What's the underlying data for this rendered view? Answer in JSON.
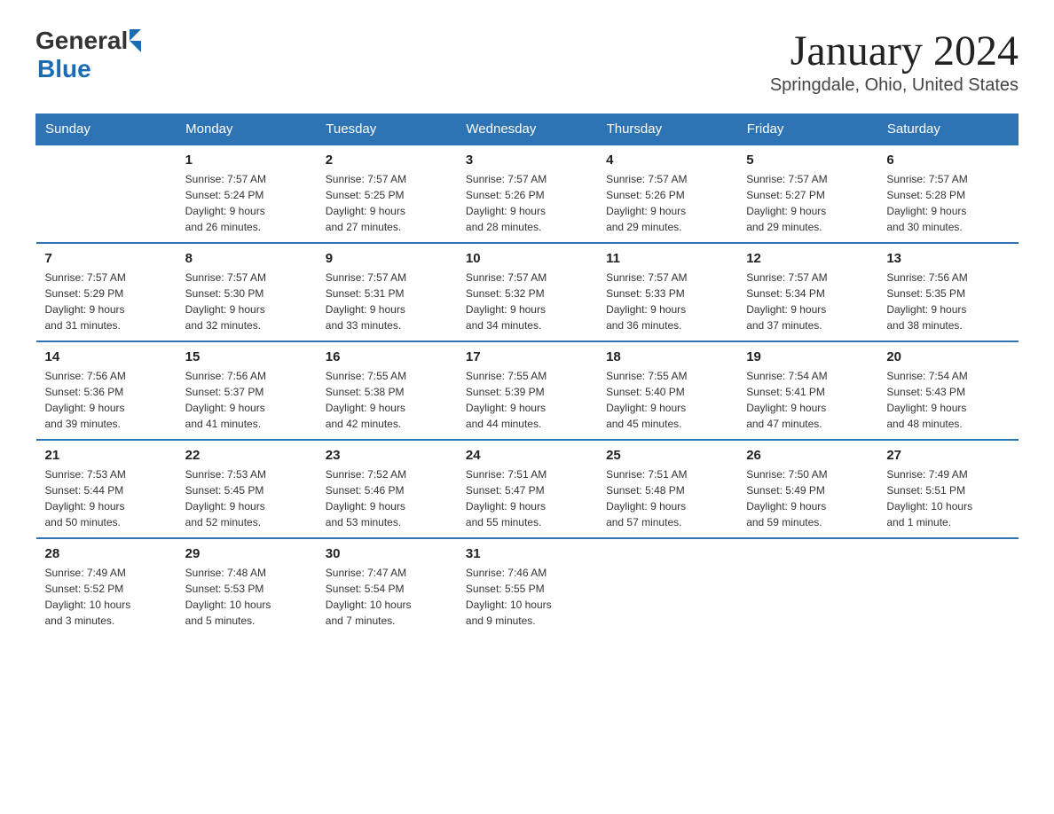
{
  "header": {
    "logo_general": "General",
    "logo_blue": "Blue",
    "month_title": "January 2024",
    "location": "Springdale, Ohio, United States"
  },
  "days_of_week": [
    "Sunday",
    "Monday",
    "Tuesday",
    "Wednesday",
    "Thursday",
    "Friday",
    "Saturday"
  ],
  "weeks": [
    [
      {
        "num": "",
        "info": ""
      },
      {
        "num": "1",
        "info": "Sunrise: 7:57 AM\nSunset: 5:24 PM\nDaylight: 9 hours\nand 26 minutes."
      },
      {
        "num": "2",
        "info": "Sunrise: 7:57 AM\nSunset: 5:25 PM\nDaylight: 9 hours\nand 27 minutes."
      },
      {
        "num": "3",
        "info": "Sunrise: 7:57 AM\nSunset: 5:26 PM\nDaylight: 9 hours\nand 28 minutes."
      },
      {
        "num": "4",
        "info": "Sunrise: 7:57 AM\nSunset: 5:26 PM\nDaylight: 9 hours\nand 29 minutes."
      },
      {
        "num": "5",
        "info": "Sunrise: 7:57 AM\nSunset: 5:27 PM\nDaylight: 9 hours\nand 29 minutes."
      },
      {
        "num": "6",
        "info": "Sunrise: 7:57 AM\nSunset: 5:28 PM\nDaylight: 9 hours\nand 30 minutes."
      }
    ],
    [
      {
        "num": "7",
        "info": "Sunrise: 7:57 AM\nSunset: 5:29 PM\nDaylight: 9 hours\nand 31 minutes."
      },
      {
        "num": "8",
        "info": "Sunrise: 7:57 AM\nSunset: 5:30 PM\nDaylight: 9 hours\nand 32 minutes."
      },
      {
        "num": "9",
        "info": "Sunrise: 7:57 AM\nSunset: 5:31 PM\nDaylight: 9 hours\nand 33 minutes."
      },
      {
        "num": "10",
        "info": "Sunrise: 7:57 AM\nSunset: 5:32 PM\nDaylight: 9 hours\nand 34 minutes."
      },
      {
        "num": "11",
        "info": "Sunrise: 7:57 AM\nSunset: 5:33 PM\nDaylight: 9 hours\nand 36 minutes."
      },
      {
        "num": "12",
        "info": "Sunrise: 7:57 AM\nSunset: 5:34 PM\nDaylight: 9 hours\nand 37 minutes."
      },
      {
        "num": "13",
        "info": "Sunrise: 7:56 AM\nSunset: 5:35 PM\nDaylight: 9 hours\nand 38 minutes."
      }
    ],
    [
      {
        "num": "14",
        "info": "Sunrise: 7:56 AM\nSunset: 5:36 PM\nDaylight: 9 hours\nand 39 minutes."
      },
      {
        "num": "15",
        "info": "Sunrise: 7:56 AM\nSunset: 5:37 PM\nDaylight: 9 hours\nand 41 minutes."
      },
      {
        "num": "16",
        "info": "Sunrise: 7:55 AM\nSunset: 5:38 PM\nDaylight: 9 hours\nand 42 minutes."
      },
      {
        "num": "17",
        "info": "Sunrise: 7:55 AM\nSunset: 5:39 PM\nDaylight: 9 hours\nand 44 minutes."
      },
      {
        "num": "18",
        "info": "Sunrise: 7:55 AM\nSunset: 5:40 PM\nDaylight: 9 hours\nand 45 minutes."
      },
      {
        "num": "19",
        "info": "Sunrise: 7:54 AM\nSunset: 5:41 PM\nDaylight: 9 hours\nand 47 minutes."
      },
      {
        "num": "20",
        "info": "Sunrise: 7:54 AM\nSunset: 5:43 PM\nDaylight: 9 hours\nand 48 minutes."
      }
    ],
    [
      {
        "num": "21",
        "info": "Sunrise: 7:53 AM\nSunset: 5:44 PM\nDaylight: 9 hours\nand 50 minutes."
      },
      {
        "num": "22",
        "info": "Sunrise: 7:53 AM\nSunset: 5:45 PM\nDaylight: 9 hours\nand 52 minutes."
      },
      {
        "num": "23",
        "info": "Sunrise: 7:52 AM\nSunset: 5:46 PM\nDaylight: 9 hours\nand 53 minutes."
      },
      {
        "num": "24",
        "info": "Sunrise: 7:51 AM\nSunset: 5:47 PM\nDaylight: 9 hours\nand 55 minutes."
      },
      {
        "num": "25",
        "info": "Sunrise: 7:51 AM\nSunset: 5:48 PM\nDaylight: 9 hours\nand 57 minutes."
      },
      {
        "num": "26",
        "info": "Sunrise: 7:50 AM\nSunset: 5:49 PM\nDaylight: 9 hours\nand 59 minutes."
      },
      {
        "num": "27",
        "info": "Sunrise: 7:49 AM\nSunset: 5:51 PM\nDaylight: 10 hours\nand 1 minute."
      }
    ],
    [
      {
        "num": "28",
        "info": "Sunrise: 7:49 AM\nSunset: 5:52 PM\nDaylight: 10 hours\nand 3 minutes."
      },
      {
        "num": "29",
        "info": "Sunrise: 7:48 AM\nSunset: 5:53 PM\nDaylight: 10 hours\nand 5 minutes."
      },
      {
        "num": "30",
        "info": "Sunrise: 7:47 AM\nSunset: 5:54 PM\nDaylight: 10 hours\nand 7 minutes."
      },
      {
        "num": "31",
        "info": "Sunrise: 7:46 AM\nSunset: 5:55 PM\nDaylight: 10 hours\nand 9 minutes."
      },
      {
        "num": "",
        "info": ""
      },
      {
        "num": "",
        "info": ""
      },
      {
        "num": "",
        "info": ""
      }
    ]
  ]
}
